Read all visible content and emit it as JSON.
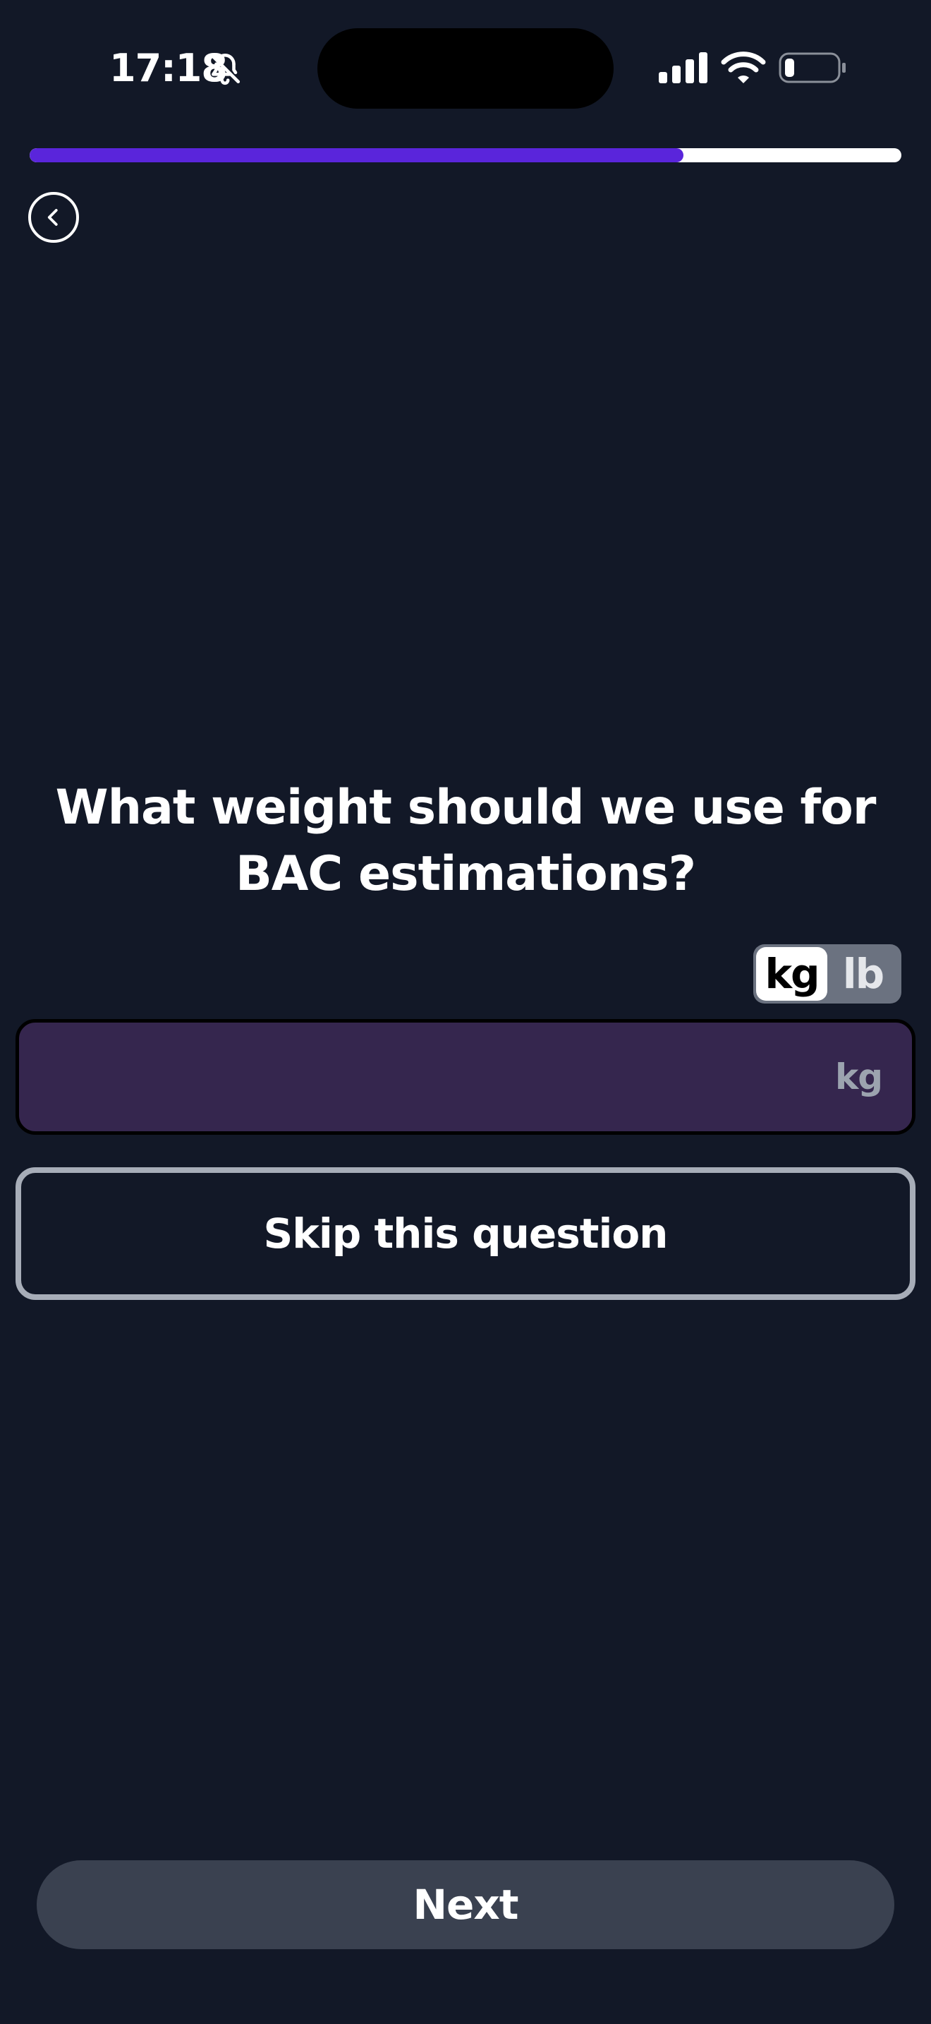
{
  "status_bar": {
    "time": "17:18",
    "icons": [
      "bell-slash-icon",
      "cellular-signal-icon",
      "wifi-icon",
      "battery-icon"
    ]
  },
  "progress": {
    "fraction": 0.75,
    "fill_color": "#5a25db",
    "track_color": "#ffffff"
  },
  "navigation": {
    "back_icon": "chevron-left-icon"
  },
  "question": {
    "title": "What weight should we use for BAC estimations?"
  },
  "unit_toggle": {
    "options": [
      "kg",
      "lb"
    ],
    "selected": "kg"
  },
  "weight_input": {
    "value": "",
    "placeholder": "",
    "unit_suffix": "kg"
  },
  "skip_button": {
    "label": "Skip this question"
  },
  "next_button": {
    "label": "Next"
  },
  "colors": {
    "background": "#121827",
    "input_background": "#35264e",
    "next_button_background": "#3a4150",
    "accent": "#5a25db"
  }
}
